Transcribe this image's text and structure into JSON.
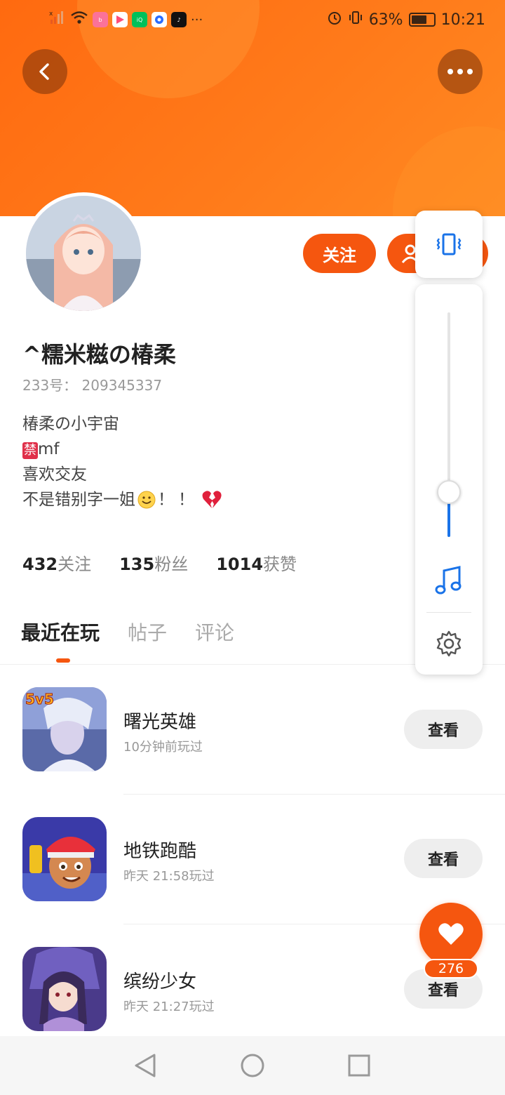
{
  "status_bar": {
    "app_icons": [
      {
        "name": "signal-off-icon",
        "color": "#e85a20"
      },
      {
        "name": "wifi-icon",
        "color": "#3a2414"
      },
      {
        "name": "bilibili-icon",
        "color": "#fb7299"
      },
      {
        "name": "video-player-icon",
        "color": "#ff4d7a"
      },
      {
        "name": "iqiyi-icon",
        "color": "#00c05a"
      },
      {
        "name": "circle-app-icon",
        "color": "#2b6cff"
      },
      {
        "name": "tiktok-icon",
        "color": "#111111"
      }
    ],
    "more_indicator": "···",
    "battery_text": "63%",
    "time": "10:21"
  },
  "profile": {
    "follow_label": "关注",
    "name": "^糯米糍の椿柔",
    "uid_label": "233号：",
    "uid_value": "209345337",
    "bio_line1": "椿柔の小宇宙",
    "bio_ban": "禁",
    "bio_line2_suffix": "mf",
    "bio_line3": "喜欢交友",
    "bio_line4": "不是错别字一姐",
    "bio_line4_suffix": "！！",
    "stats": [
      {
        "value": "432",
        "label": "关注"
      },
      {
        "value": "135",
        "label": "粉丝"
      },
      {
        "value": "1014",
        "label": "获赞"
      }
    ]
  },
  "tabs": [
    {
      "label": "最近在玩",
      "active": true
    },
    {
      "label": "帖子",
      "active": false
    },
    {
      "label": "评论",
      "active": false
    }
  ],
  "games": [
    {
      "name": "曙光英雄",
      "time": "10分钟前玩过",
      "button": "查看",
      "badge": "5v5"
    },
    {
      "name": "地铁跑酷",
      "time": "昨天 21:58玩过",
      "button": "查看"
    },
    {
      "name": "缤纷少女",
      "time": "昨天 21:27玩过",
      "button": "查看"
    }
  ],
  "like": {
    "count": "276"
  },
  "volume": {
    "level": 0.2
  },
  "colors": {
    "accent": "#f5560f",
    "header": "#ff7a1a",
    "volume_blue": "#1a73e8"
  }
}
